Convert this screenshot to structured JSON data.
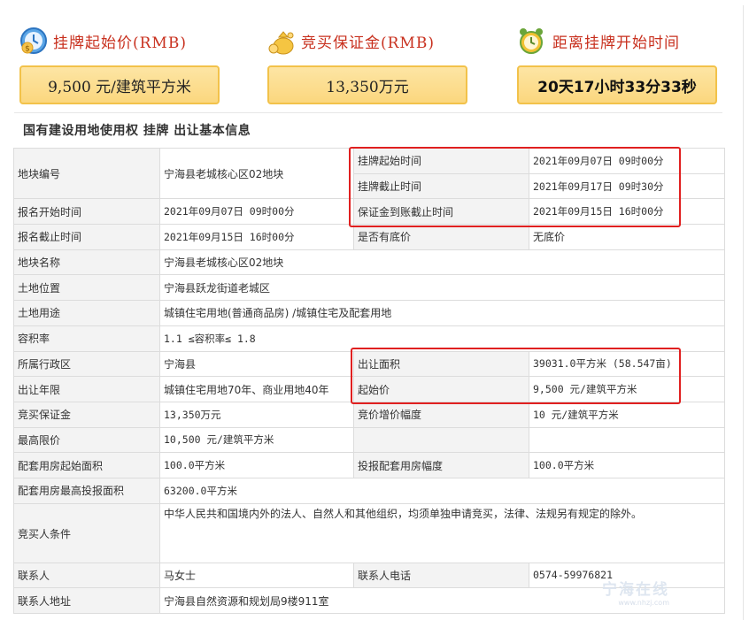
{
  "header": {
    "start_price": {
      "icon": "dollar-clock-icon",
      "title": "挂牌起始价(RMB)",
      "value": "9,500 元/建筑平方米"
    },
    "deposit": {
      "icon": "money-bag-icon",
      "title": "竞买保证金(RMB)",
      "value": "13,350万元"
    },
    "countdown": {
      "icon": "alarm-clock-icon",
      "title": "距离挂牌开始时间",
      "value": "20天17小时33分33秒"
    }
  },
  "section_title": "国有建设用地使用权 挂牌 出让基本信息",
  "rows": {
    "r1": {
      "l1": "地块编号",
      "v1": "宁海县老城核心区02地块",
      "l2a": "挂牌起始时间",
      "v2a": "2021年09月07日 09时00分",
      "l2b": "挂牌截止时间",
      "v2b": "2021年09月17日 09时30分"
    },
    "r2": {
      "l1": "报名开始时间",
      "v1": "2021年09月07日 09时00分",
      "l2": "保证金到账截止时间",
      "v2": "2021年09月15日 16时00分"
    },
    "r3": {
      "l1": "报名截止时间",
      "v1": "2021年09月15日 16时00分",
      "l2": "是否有底价",
      "v2": "无底价"
    },
    "r4": {
      "l1": "地块名称",
      "v1": "宁海县老城核心区02地块"
    },
    "r5": {
      "l1": "土地位置",
      "v1": "宁海县跃龙街道老城区"
    },
    "r6": {
      "l1": "土地用途",
      "v1": "城镇住宅用地(普通商品房) /城镇住宅及配套用地"
    },
    "r7": {
      "l1": "容积率",
      "v1": "1.1 ≤容积率≤ 1.8"
    },
    "r8": {
      "l1": "所属行政区",
      "v1": "宁海县",
      "l2": "出让面积",
      "v2": "39031.0平方米 (58.547亩)"
    },
    "r9": {
      "l1": "出让年限",
      "v1": "城镇住宅用地70年、商业用地40年",
      "l2": "起始价",
      "v2": "9,500 元/建筑平方米"
    },
    "r10": {
      "l1": "竞买保证金",
      "v1": "13,350万元",
      "l2": "竞价增价幅度",
      "v2": "10 元/建筑平方米"
    },
    "r11": {
      "l1": "最高限价",
      "v1": "10,500 元/建筑平方米",
      "l2": "",
      "v2": ""
    },
    "r12": {
      "l1": "配套用房起始面积",
      "v1": "100.0平方米",
      "l2": "投报配套用房幅度",
      "v2": "100.0平方米"
    },
    "r13": {
      "l1": "配套用房最高投报面积",
      "v1": "63200.0平方米"
    },
    "r14": {
      "l1": "竞买人条件",
      "v1": "中华人民共和国境内外的法人、自然人和其他组织，均须单独申请竞买，法律、法规另有规定的除外。"
    },
    "r15": {
      "l1": "联系人",
      "v1": "马女士",
      "l2": "联系人电话",
      "v2": "0574-59976821"
    },
    "r16": {
      "l1": "联系人地址",
      "v1": "宁海县自然资源和规划局9楼911室"
    }
  },
  "watermark": {
    "text": "宁海在线",
    "sub": "www.nhzj.com"
  },
  "colors": {
    "title_red": "#c8301e",
    "box_fill": "#fbd77e",
    "box_border": "#f2c24a",
    "highlight": "#e02020"
  }
}
